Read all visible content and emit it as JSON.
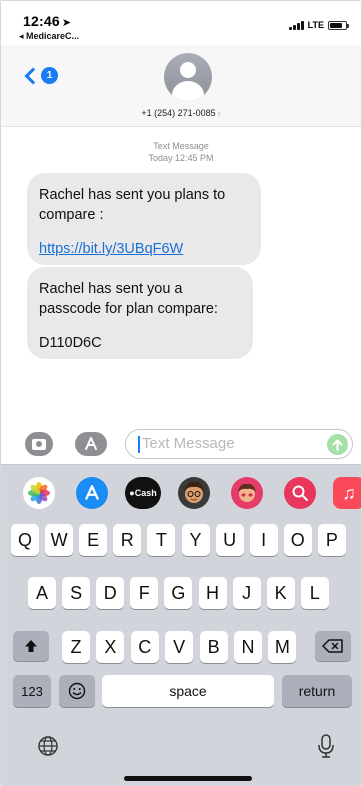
{
  "status_bar": {
    "time": "12:46",
    "location_icon": "location-arrow-icon",
    "back_app": "◂ MedicareC...",
    "network": "LTE",
    "battery_level": 0.8
  },
  "header": {
    "back_badge": "1",
    "contact_number": "+1 (254) 271-0085",
    "contact_chevron": "›"
  },
  "messages": {
    "meta_line1": "Text Message",
    "meta_line2": "Today 12:45 PM",
    "bubbles": [
      {
        "text": "Rachel has sent you plans to compare :",
        "link": "https://bit.ly/3UBqF6W"
      },
      {
        "text": "Rachel has sent you a passcode for plan compare:",
        "code": "D110D6C"
      }
    ]
  },
  "compose": {
    "placeholder": "Text Message"
  },
  "app_drawer": {
    "items": [
      {
        "name": "photos",
        "label": "",
        "color": "#ffffff"
      },
      {
        "name": "app-store",
        "label": "",
        "color": "#1a8cf5"
      },
      {
        "name": "apple-cash",
        "label": "Cash",
        "color": "#111111"
      },
      {
        "name": "memoji",
        "label": "",
        "color": "#3a3a3a"
      },
      {
        "name": "animoji",
        "label": "",
        "color": "#e53c6a"
      },
      {
        "name": "image-search",
        "label": "",
        "color": "#e8365c"
      },
      {
        "name": "music",
        "label": "",
        "color": "#fa4a5a"
      }
    ]
  },
  "keyboard": {
    "row1": [
      "Q",
      "W",
      "E",
      "R",
      "T",
      "Y",
      "U",
      "I",
      "O",
      "P"
    ],
    "row2": [
      "A",
      "S",
      "D",
      "F",
      "G",
      "H",
      "J",
      "K",
      "L"
    ],
    "row3": [
      "Z",
      "X",
      "C",
      "V",
      "B",
      "N",
      "M"
    ],
    "numbers_label": "123",
    "space_label": "space",
    "return_label": "return"
  }
}
